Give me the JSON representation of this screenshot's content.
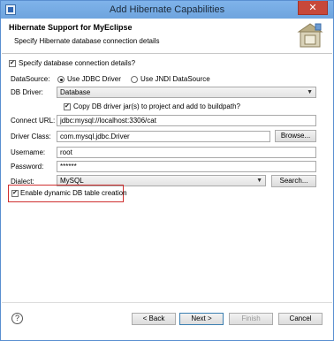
{
  "window": {
    "title": "Add Hibernate Capabilities",
    "close_glyph": "✕"
  },
  "banner": {
    "heading": "Hibernate Support for MyEclipse",
    "description": "Specify Hibernate database connection details",
    "icon": "hibernate-wizard-icon"
  },
  "form": {
    "specify_details_label": "Specify database connection details?",
    "datasource": {
      "label": "DataSource:",
      "options": [
        "Use JDBC Driver",
        "Use JNDI DataSource"
      ],
      "selected": "Use JDBC Driver"
    },
    "db_driver": {
      "label": "DB Driver:",
      "value": "Database"
    },
    "copy_jars_label": "Copy DB driver jar(s) to project and add to buildpath?",
    "connect_url": {
      "label": "Connect URL:",
      "value": "jdbc:mysql://localhost:3306/cat"
    },
    "driver_class": {
      "label": "Driver Class:",
      "value": "com.mysql.jdbc.Driver",
      "browse_label": "Browse..."
    },
    "username": {
      "label": "Username:",
      "value": "root"
    },
    "password": {
      "label": "Password:",
      "value": "******"
    },
    "dialect": {
      "label": "Dialect:",
      "value": "MySQL",
      "search_label": "Search..."
    },
    "dynamic_table_label": "Enable dynamic DB table creation"
  },
  "footer": {
    "help_glyph": "?",
    "back_label": "< Back",
    "next_label": "Next >",
    "finish_label": "Finish",
    "cancel_label": "Cancel"
  },
  "colors": {
    "title_bar": "#6ea4de",
    "highlight_box": "#cf2f2f"
  }
}
